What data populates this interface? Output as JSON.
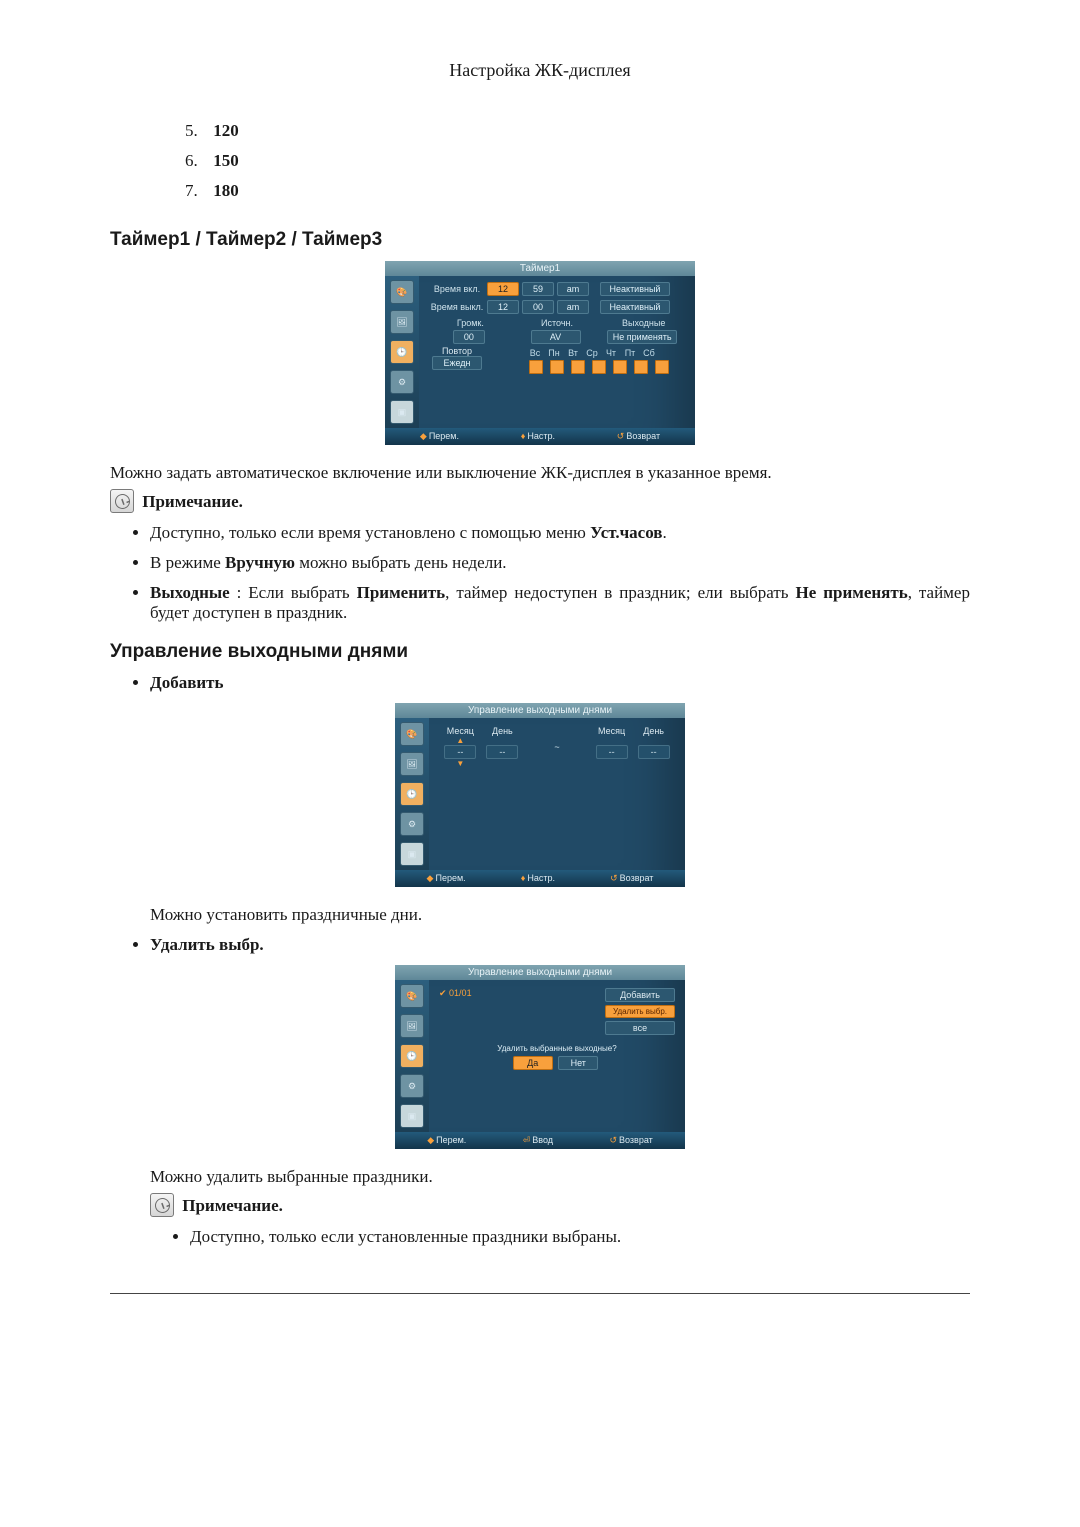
{
  "page_title": "Настройка ЖК-дисплея",
  "num_list": [
    {
      "index": "5.",
      "value": "120"
    },
    {
      "index": "6.",
      "value": "150"
    },
    {
      "index": "7.",
      "value": "180"
    }
  ],
  "section_timer": {
    "heading": "Таймер1 / Таймер2 / Таймер3",
    "osd": {
      "title": "Таймер1",
      "on_label": "Время вкл.",
      "on_h": "12",
      "on_m": "59",
      "on_ampm": "am",
      "on_state": "Неактивный",
      "off_label": "Время выкл.",
      "off_h": "12",
      "off_m": "00",
      "off_ampm": "am",
      "off_state": "Неактивный",
      "col_volume": "Громк.",
      "col_source": "Источн.",
      "col_holiday": "Выходные",
      "val_volume": "00",
      "val_source": "AV",
      "val_holiday": "Не применять",
      "repeat_label": "Повтор",
      "repeat_value": "Ежедн",
      "days": [
        "Вс",
        "Пн",
        "Вт",
        "Ср",
        "Чт",
        "Пт",
        "Сб"
      ],
      "foot_move": "Перем.",
      "foot_adjust": "Настр.",
      "foot_return": "Возврат"
    },
    "paragraph": "Можно задать автоматическое включение или выключение ЖК-дисплея в указанное время.",
    "note_label": "Примечание.",
    "bullets": {
      "b1_prefix": "Доступно, только если время установлено с помощью меню ",
      "b1_bold": "Уст.часов",
      "b1_suffix": ".",
      "b2_prefix": "В режиме ",
      "b2_bold": "Вручную",
      "b2_suffix": " можно выбрать день недели.",
      "b3_bold1": "Выходные",
      "b3_mid1": " : Если выбрать ",
      "b3_bold2": "Применить",
      "b3_mid2": ", таймер недоступен в праздник; ели выбрать ",
      "b3_bold3": "Не применять",
      "b3_suffix": ", таймер будет доступен в праздник."
    }
  },
  "section_holiday": {
    "heading": "Управление выходными днями",
    "item_add": "Добавить",
    "osd_add": {
      "title": "Управление выходными днями",
      "month": "Месяц",
      "day": "День",
      "field": "--",
      "sep": "~",
      "foot_move": "Перем.",
      "foot_adjust": "Настр.",
      "foot_return": "Возврат"
    },
    "add_paragraph": "Можно установить праздничные дни.",
    "item_delete": "Удалить выбр.",
    "osd_del": {
      "title": "Управление выходными днями",
      "entry": "01/01",
      "btn_add": "Добавить",
      "btn_del": "Удалить выбр.",
      "btn_all": "все",
      "confirm": "Удалить выбранные выходные?",
      "yes": "Да",
      "no": "Нет",
      "foot_move": "Перем.",
      "foot_enter": "Ввод",
      "foot_return": "Возврат"
    },
    "del_paragraph": "Можно удалить выбранные праздники.",
    "note_label": "Примечание.",
    "note_bullet": "Доступно, только если установленные праздники выбраны."
  }
}
